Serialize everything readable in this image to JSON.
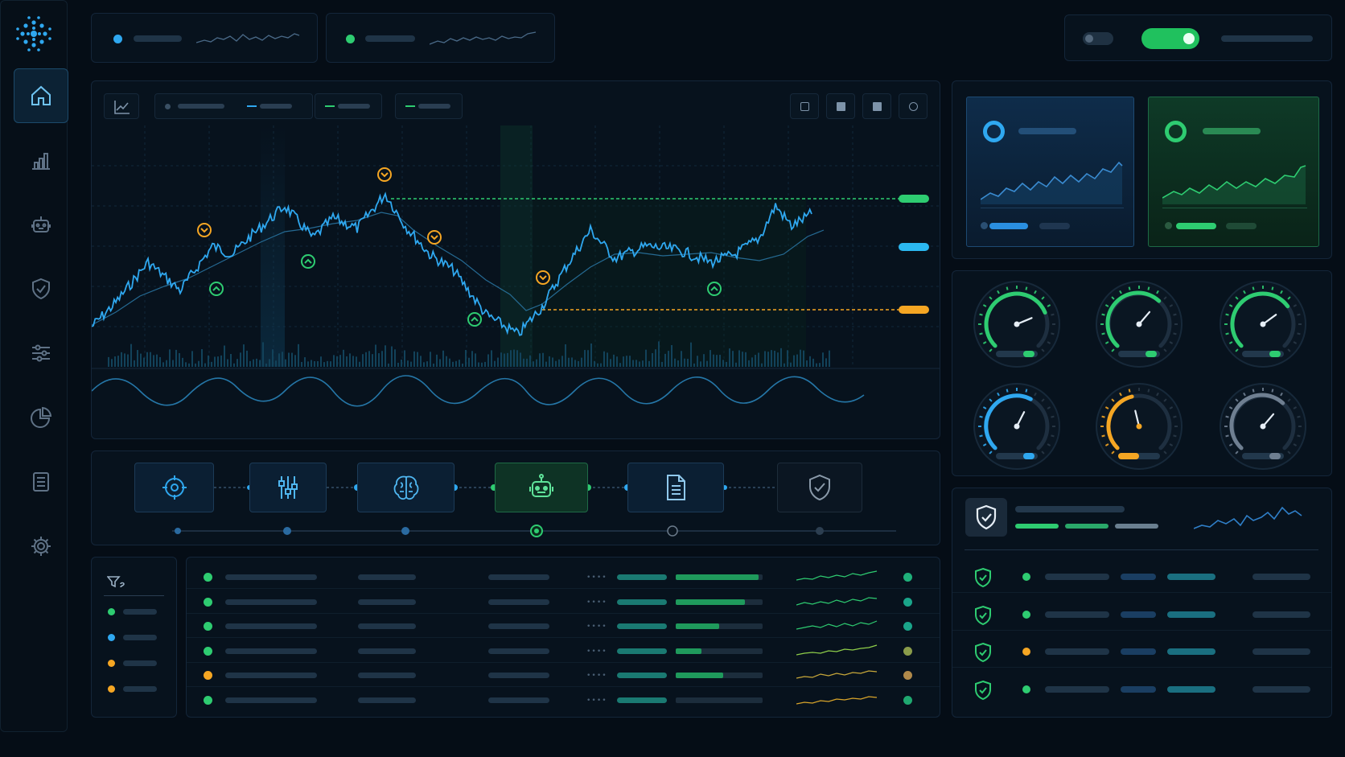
{
  "sidebar": {
    "logo_icon": "atom-logo-icon",
    "items": [
      {
        "icon": "home-icon",
        "active": true
      },
      {
        "icon": "bar-chart-icon",
        "active": false
      },
      {
        "icon": "robot-icon",
        "active": false
      },
      {
        "icon": "shield-icon",
        "active": false
      },
      {
        "icon": "sliders-icon",
        "active": false
      },
      {
        "icon": "pie-chart-icon",
        "active": false
      },
      {
        "icon": "document-icon",
        "active": false
      },
      {
        "icon": "gear-icon",
        "active": false
      }
    ]
  },
  "header": {
    "tickers": [
      {
        "status_color": "#2fa8f0"
      },
      {
        "status_color": "#2ecc71"
      }
    ],
    "toggles": [
      {
        "on": false
      },
      {
        "on": true,
        "color": "#2ecc71"
      }
    ]
  },
  "main_chart": {
    "toolbar_left": [
      "line-chart-icon",
      "legend-series-1",
      "legend-series-2",
      "legend-series-3"
    ],
    "toolbar_right": [
      "square-outline-icon",
      "square-filled-icon",
      "square-filled-icon",
      "circle-outline-icon"
    ],
    "markers": [
      {
        "kind": "sell",
        "label_color": "#f5a623"
      },
      {
        "kind": "buy",
        "label_color": "#2ecc71"
      }
    ],
    "level_tags": [
      {
        "color": "#2ecc71"
      },
      {
        "color": "#2bb8f0"
      },
      {
        "color": "#f5a623"
      }
    ]
  },
  "pipeline": {
    "steps": [
      {
        "icon": "target-icon",
        "state": "done"
      },
      {
        "icon": "sliders-icon",
        "state": "done"
      },
      {
        "icon": "brain-icon",
        "state": "done"
      },
      {
        "icon": "robot-icon",
        "state": "active"
      },
      {
        "icon": "document-icon",
        "state": "pending"
      },
      {
        "icon": "shield-check-icon",
        "state": "pending"
      }
    ]
  },
  "filter_panel": {
    "icon": "filter-icon",
    "status_colors": [
      "#2ecc71",
      "#2fa8f0",
      "#f5a623",
      "#f5a623"
    ]
  },
  "data_table": {
    "rows": [
      {
        "status": "#2ecc71",
        "progress": 0.95,
        "end": "#1fb07a",
        "spark": "#2ecc71"
      },
      {
        "status": "#2ecc71",
        "progress": 0.8,
        "end": "#1aa58a",
        "spark": "#2ecc71"
      },
      {
        "status": "#2ecc71",
        "progress": 0.5,
        "end": "#1aa58a",
        "spark": "#2ecc71"
      },
      {
        "status": "#2ecc71",
        "progress": 0.3,
        "end": "#8a9c4a",
        "spark": "#8fcf4a"
      },
      {
        "status": "#f5a623",
        "progress": 0.55,
        "end": "#b0894a",
        "spark": "#c8a83a"
      },
      {
        "status": "#2ecc71",
        "progress": 0.0,
        "end": "#1fa870",
        "spark": "#d9a52a"
      }
    ]
  },
  "stat_cards": [
    {
      "ring_color": "#2fa8f0",
      "accent": "#2fa8f0"
    },
    {
      "ring_color": "#2ecc71",
      "accent": "#2ecc71"
    }
  ],
  "gauges": [
    {
      "color": "#2ecc71",
      "level": 0.75
    },
    {
      "color": "#2ecc71",
      "level": 0.65
    },
    {
      "color": "#2ecc71",
      "level": 0.7
    },
    {
      "color": "#2fa8f0",
      "level": 0.6
    },
    {
      "color": "#f5a623",
      "level": 0.45
    },
    {
      "color": "#6f7f91",
      "level": 0.65
    }
  ],
  "security_panel": {
    "icon": "shield-check-icon",
    "rows": [
      {
        "icon": "shield-check-icon",
        "status": "#2ecc71"
      },
      {
        "icon": "shield-check-icon",
        "status": "#2ecc71"
      },
      {
        "icon": "shield-check-icon",
        "status": "#f5a623"
      },
      {
        "icon": "shield-check-icon",
        "status": "#2ecc71"
      }
    ]
  }
}
